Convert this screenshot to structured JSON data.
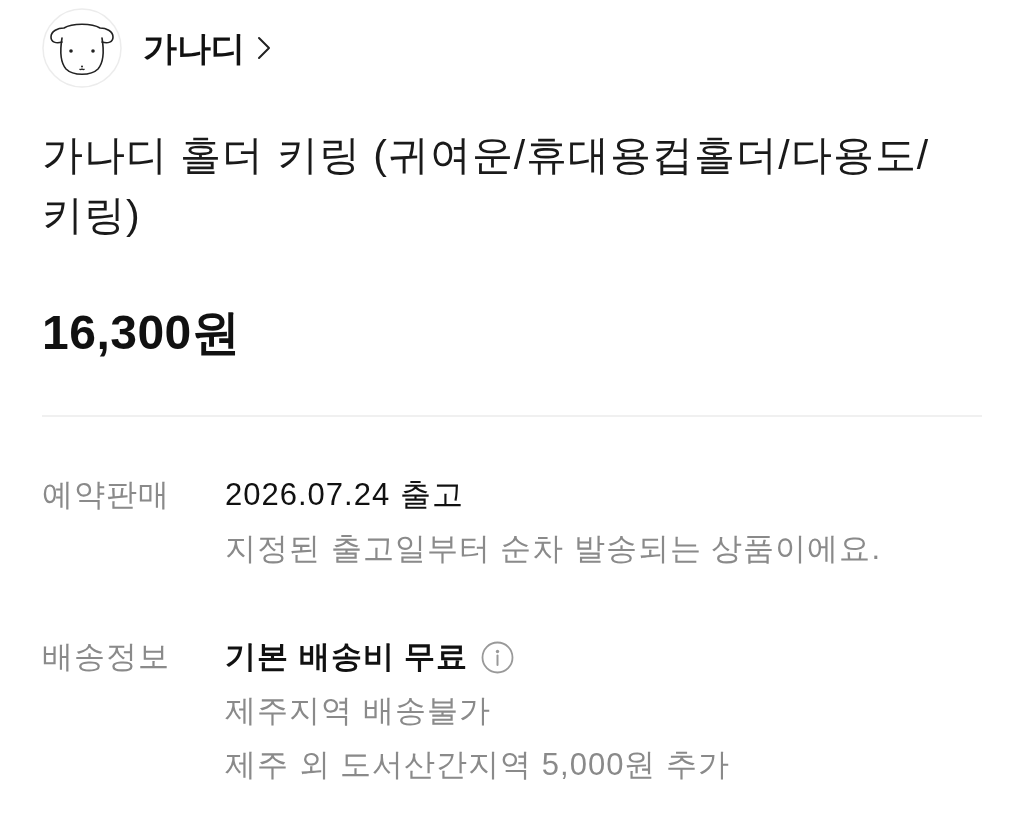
{
  "store": {
    "name": "가나디"
  },
  "product": {
    "title": "가나디 홀더 키링 (귀여운/휴대용컵홀더/다용도/키링)",
    "price": "16,300원"
  },
  "details": [
    {
      "label": "예약판매",
      "lines": [
        {
          "text": "2026.07.24 출고",
          "kind": "primary"
        },
        {
          "text": "지정된 출고일부터 순차 발송되는 상품이에요.",
          "kind": "note"
        }
      ]
    },
    {
      "label": "배송정보",
      "lines": [
        {
          "text": "기본 배송비 무료",
          "kind": "emphasis",
          "info": true
        },
        {
          "text": "제주지역 배송불가",
          "kind": "note"
        },
        {
          "text": "제주 외 도서산간지역 5,000원 추가",
          "kind": "note"
        }
      ]
    }
  ]
}
